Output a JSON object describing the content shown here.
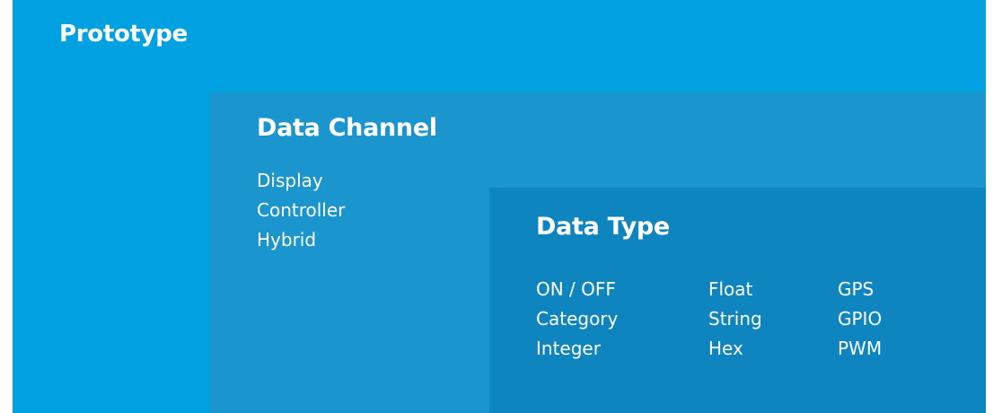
{
  "prototype": {
    "title": "Prototype"
  },
  "data_channel": {
    "title": "Data Channel",
    "items": [
      "Display",
      "Controller",
      "Hybrid"
    ]
  },
  "data_type": {
    "title": "Data Type",
    "columns": [
      [
        "ON / OFF",
        "Category",
        "Integer"
      ],
      [
        "Float",
        "String",
        "Hex"
      ],
      [
        "GPS",
        "GPIO",
        "PWM"
      ]
    ]
  },
  "colors": {
    "prototype_bg": "#00A1E0",
    "channel_bg": "#1A95CD",
    "type_bg": "#0E85BE",
    "text": "#FFFFFF"
  }
}
